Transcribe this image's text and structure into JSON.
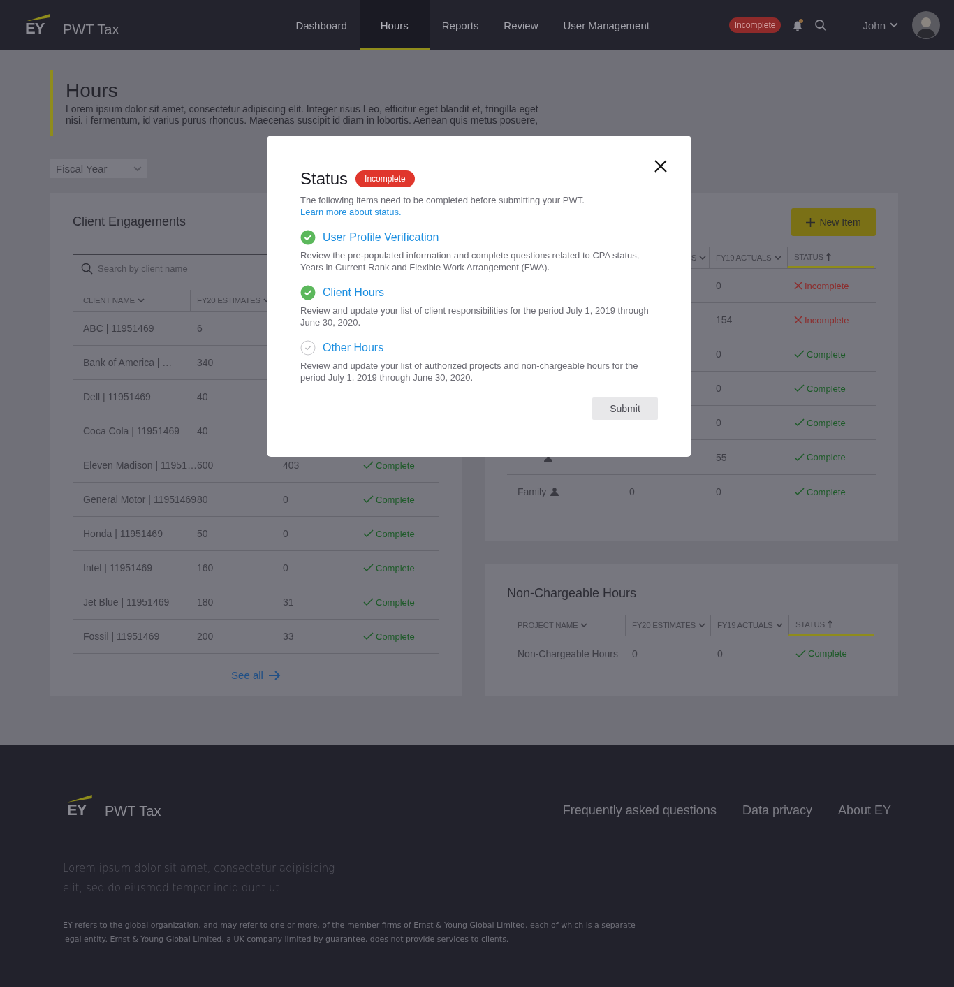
{
  "header": {
    "logo": "EY",
    "app_name": "PWT Tax",
    "nav": [
      {
        "label": "Dashboard",
        "selected": false
      },
      {
        "label": "Hours",
        "selected": true
      },
      {
        "label": "Reports",
        "selected": false
      },
      {
        "label": "Review",
        "selected": false
      },
      {
        "label": "User Management",
        "selected": false
      }
    ],
    "status_badge": "Incomplete",
    "notification_dot": true,
    "user": "John"
  },
  "page": {
    "title": "Hours",
    "description": "Lorem ipsum dolor sit amet, consectetur adipiscing elit. Integer risus Leo, efficitur eget blandit et, fringilla eget nisi. i fermentum, id varius purus rhoncus. Maecenas suscipit id diam in lobortis. Aenean quis metus posuere,"
  },
  "fiscal_year": {
    "placeholder": "Fiscal Year"
  },
  "client_engagements": {
    "title": "Client Engagements",
    "search": {
      "placeholder": "Search by client name"
    },
    "columns": [
      {
        "label": "CLIENT NAME",
        "selected": false
      },
      {
        "label": "FY20 ESTIMATES",
        "selected": false
      }
    ],
    "rows": [
      {
        "name": "ABC | 11951469",
        "fy20": "6"
      },
      {
        "name": "Bank of America | …",
        "fy20": "340"
      },
      {
        "name": "Dell | 11951469",
        "fy20": "40"
      },
      {
        "name": "Coca Cola | 11951469",
        "fy20": "40"
      },
      {
        "name": "Eleven Madison | 11951…",
        "fy20": "600",
        "fy19": "403",
        "status": {
          "text": "Complete",
          "kind": "complete"
        }
      },
      {
        "name": "General Motor | 11951469",
        "fy20": "80",
        "fy19": "0",
        "status": {
          "text": "Complete",
          "kind": "complete"
        }
      },
      {
        "name": "Honda | 11951469",
        "fy20": "50",
        "fy19": "0",
        "status": {
          "text": "Complete",
          "kind": "complete"
        }
      },
      {
        "name": "Intel | 11951469",
        "fy20": "160",
        "fy19": "0",
        "status": {
          "text": "Complete",
          "kind": "complete"
        }
      },
      {
        "name": "Jet Blue | 11951469",
        "fy20": "180",
        "fy19": "31",
        "status": {
          "text": "Complete",
          "kind": "complete"
        }
      },
      {
        "name": "Fossil | 11951469",
        "fy20": "200",
        "fy19": "33",
        "status": {
          "text": "Complete",
          "kind": "complete"
        }
      }
    ],
    "see_all": "See all"
  },
  "other_hours": {
    "new_button": "New Item",
    "columns": [
      {},
      {
        "label": "S",
        "selected": false
      },
      {
        "label": "FY19 ACTUALS",
        "selected": false
      },
      {
        "label": "STATUS",
        "selected": true
      }
    ],
    "rows": [
      {
        "fy19": "0",
        "status": {
          "text": "Incomplete",
          "kind": "incomplete"
        }
      },
      {
        "fy19": "154",
        "status": {
          "text": "Incomplete",
          "kind": "incomplete"
        }
      },
      {
        "fy19": "0",
        "status": {
          "text": "Complete",
          "kind": "complete"
        }
      },
      {
        "fy19": "0",
        "status": {
          "text": "Complete",
          "kind": "complete"
        }
      },
      {
        "fy19": "0",
        "status": {
          "text": "Complete",
          "kind": "complete"
        }
      },
      {
        "personal": true,
        "fy19": "55",
        "status": {
          "text": "Complete",
          "kind": "complete"
        }
      },
      {
        "name": "Family",
        "personal": true,
        "fy20": "0",
        "fy19": "0",
        "status": {
          "text": "Complete",
          "kind": "complete"
        }
      }
    ]
  },
  "non_chargeable": {
    "title": "Non-Chargeable Hours",
    "columns": [
      {
        "label": "PROJECT NAME",
        "selected": false
      },
      {
        "label": "FY20 ESTIMATES",
        "selected": false
      },
      {
        "label": "FY19 ACTUALS",
        "selected": false
      },
      {
        "label": "STATUS",
        "selected": true
      }
    ],
    "rows": [
      {
        "name": "Non-Chargeable Hours",
        "fy20": "0",
        "fy19": "0",
        "status": {
          "text": "Complete",
          "kind": "complete"
        }
      }
    ]
  },
  "modal": {
    "title": "Status",
    "badge": "Incomplete",
    "intro": "The following items need to be completed before submitting your PWT.",
    "link": "Learn more about status.",
    "items": [
      {
        "title": "User Profile Verification",
        "done": true,
        "text": "Review the pre-populated information and complete questions related to CPA status, Years in Current Rank and Flexible Work Arrangement (FWA)."
      },
      {
        "title": "Client Hours",
        "done": true,
        "text": "Review and update your list of client responsibilities for the period July 1, 2019 through June 30, 2020."
      },
      {
        "title": "Other Hours",
        "done": false,
        "text": "Review and update your list of authorized projects and non-chargeable hours for the period July 1, 2019 through June 30, 2020."
      }
    ],
    "submit": "Submit"
  },
  "footer": {
    "logo": "EY",
    "app_name": "PWT Tax",
    "links": [
      "Frequently asked questions",
      "Data privacy",
      "About EY"
    ],
    "tagline": "Lorem ipsum dolor sit amet, consectetur adipisicing elit, sed do eiusmod tempor incididunt ut",
    "legal": "EY refers to the global organization, and may refer to one or more, of the member firms of Ernst & Young Global Limited, each of which is a separate legal entity. Ernst & Young Global Limited, a UK company limited by guarantee, does not provide services to clients."
  }
}
